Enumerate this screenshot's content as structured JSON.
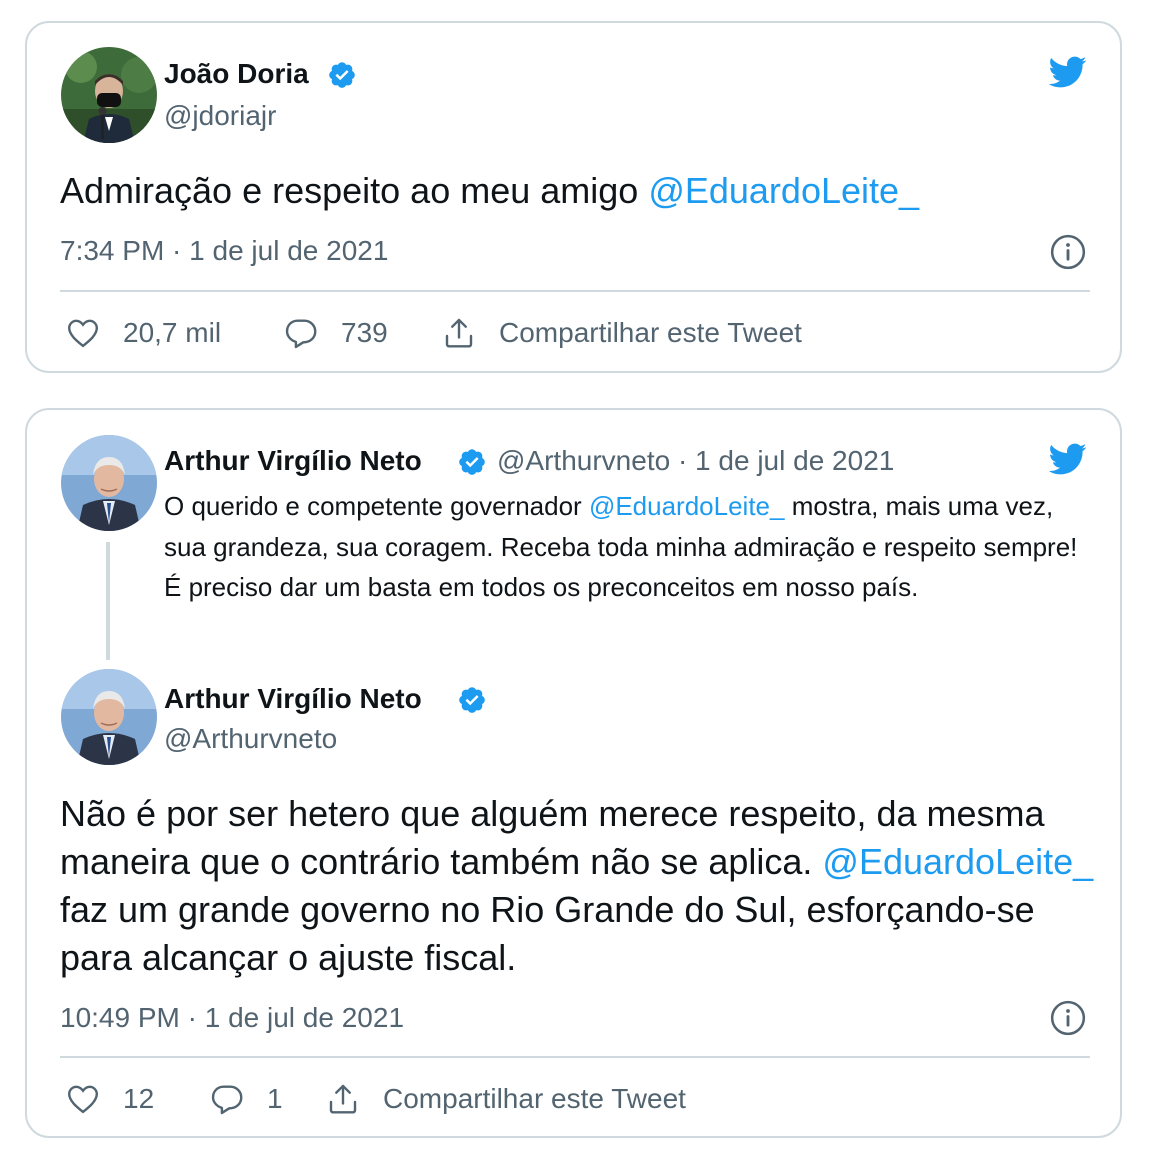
{
  "tweet1": {
    "author_name": "João Doria",
    "author_handle": "@jdoriajr",
    "text_before": "Admiração e respeito ao meu amigo ",
    "mention": "@EduardoLeite_",
    "timestamp": "7:34 PM · 1 de jul de 2021",
    "likes": "20,7 mil",
    "replies": "739",
    "share_label": "Compartilhar este Tweet"
  },
  "tweet2": {
    "quoted": {
      "author_name": "Arthur Virgílio Neto",
      "author_handle": "@Arthurvneto",
      "date": "· 1 de jul de 2021",
      "text_part1": "O querido e competente governador ",
      "mention": "@EduardoLeite_",
      "text_part2": " mostra, mais uma vez, sua grandeza, sua coragem. Receba toda minha admiração e respeito sempre! É preciso dar um basta em todos os preconceitos em nosso país."
    },
    "author_name": "Arthur Virgílio Neto",
    "author_handle": "@Arthurvneto",
    "text_part1": "Não é por ser hetero que alguém merece respeito, da mesma maneira que o contrário também não se aplica. ",
    "mention": "@EduardoLeite_",
    "text_part2": " faz um grande governo no Rio Grande do Sul, esforçando-se para alcançar o ajuste fiscal.",
    "timestamp": "10:49 PM · 1 de jul de 2021",
    "likes": "12",
    "replies": "1",
    "share_label": "Compartilhar este Tweet"
  },
  "colors": {
    "link": "#1d9bf0",
    "text": "#0f1419",
    "secondary": "#536471",
    "border": "#cfd9de",
    "verified": "#1d9bf0"
  }
}
